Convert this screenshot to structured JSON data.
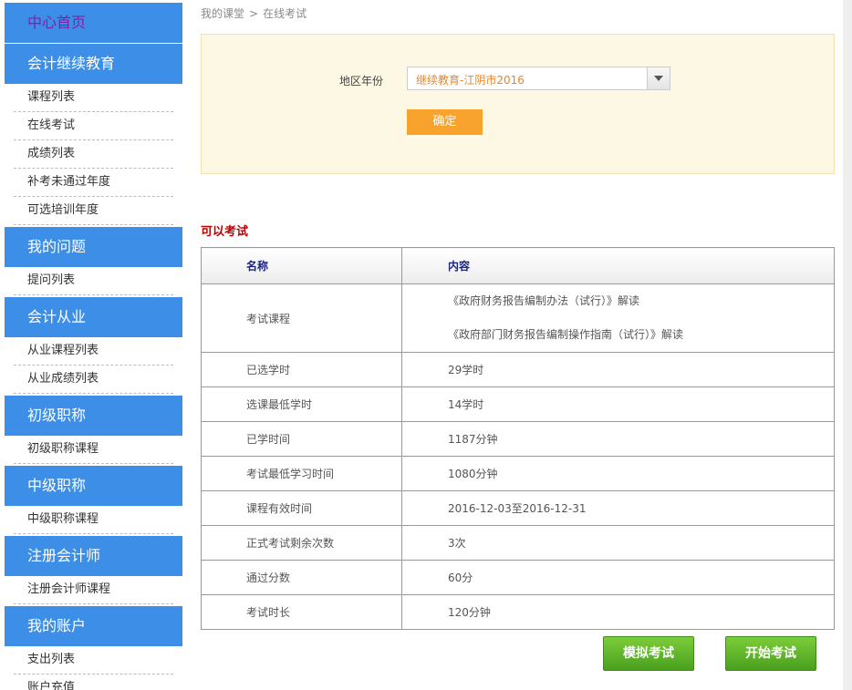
{
  "sidebar": {
    "home": "中心首页",
    "sections": [
      {
        "title": "会计继续教育",
        "items": [
          "课程列表",
          "在线考试",
          "成绩列表",
          "补考未通过年度",
          "可选培训年度"
        ]
      },
      {
        "title": "我的问题",
        "items": [
          "提问列表"
        ]
      },
      {
        "title": "会计从业",
        "items": [
          "从业课程列表",
          "从业成绩列表"
        ]
      },
      {
        "title": "初级职称",
        "items": [
          "初级职称课程"
        ]
      },
      {
        "title": "中级职称",
        "items": [
          "中级职称课程"
        ]
      },
      {
        "title": "注册会计师",
        "items": [
          "注册会计师课程"
        ]
      },
      {
        "title": "我的账户",
        "items": [
          "支出列表",
          "账户充值"
        ]
      }
    ]
  },
  "breadcrumb": {
    "parent": "我的课堂",
    "separator": ">",
    "current": "在线考试"
  },
  "filter": {
    "label": "地区年份",
    "selected": "继续教育-江阴市2016",
    "confirm": "确定"
  },
  "section_title": "可以考试",
  "table": {
    "headers": [
      "名称",
      "内容"
    ],
    "courses_label": "考试课程",
    "courses": [
      "《政府财务报告编制办法（试行）》解读",
      "《政府部门财务报告编制操作指南（试行）》解读"
    ],
    "rows": [
      {
        "name": "已选学时",
        "value": "29学时"
      },
      {
        "name": "选课最低学时",
        "value": "14学时"
      },
      {
        "name": "已学时间",
        "value": "1187分钟"
      },
      {
        "name": "考试最低学习时间",
        "value": "1080分钟"
      },
      {
        "name": "课程有效时间",
        "value": "2016-12-03至2016-12-31"
      },
      {
        "name": "正式考试剩余次数",
        "value": "3次"
      },
      {
        "name": "通过分数",
        "value": "60分"
      },
      {
        "name": "考试时长",
        "value": "120分钟"
      }
    ]
  },
  "buttons": {
    "mock": "模拟考试",
    "start": "开始考试"
  },
  "colors": {
    "sidebar_header": "#3d8ee6",
    "home_text": "#8b1aa8",
    "confirm": "#f7a32e",
    "green_button": "#4aa01e",
    "section_title": "#c00000",
    "filter_bg": "#fdf8e4"
  }
}
